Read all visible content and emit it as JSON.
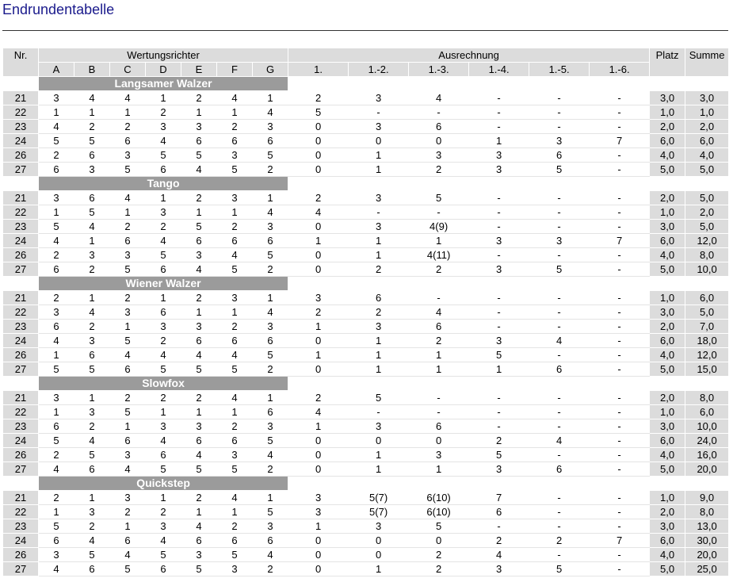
{
  "page_title": "Endrundentabelle",
  "headers": {
    "nr": "Nr.",
    "judges_group": "Wertungsrichter",
    "calc_group": "Ausrechnung",
    "platz": "Platz",
    "summe": "Summe",
    "judges": [
      "A",
      "B",
      "C",
      "D",
      "E",
      "F",
      "G"
    ],
    "calc": [
      "1.",
      "1.-2.",
      "1.-3.",
      "1.-4.",
      "1.-5.",
      "1.-6."
    ]
  },
  "dances": [
    {
      "name": "Langsamer Walzer",
      "rows": [
        {
          "nr": "21",
          "marks": [
            "3",
            "4",
            "4",
            "1",
            "2",
            "4",
            "1"
          ],
          "calc": [
            "2",
            "3",
            "4",
            "-",
            "-",
            "-"
          ],
          "platz": "3,0",
          "summe": "3,0"
        },
        {
          "nr": "22",
          "marks": [
            "1",
            "1",
            "1",
            "2",
            "1",
            "1",
            "4"
          ],
          "calc": [
            "5",
            "-",
            "-",
            "-",
            "-",
            "-"
          ],
          "platz": "1,0",
          "summe": "1,0"
        },
        {
          "nr": "23",
          "marks": [
            "4",
            "2",
            "2",
            "3",
            "3",
            "2",
            "3"
          ],
          "calc": [
            "0",
            "3",
            "6",
            "-",
            "-",
            "-"
          ],
          "platz": "2,0",
          "summe": "2,0"
        },
        {
          "nr": "24",
          "marks": [
            "5",
            "5",
            "6",
            "4",
            "6",
            "6",
            "6"
          ],
          "calc": [
            "0",
            "0",
            "0",
            "1",
            "3",
            "7"
          ],
          "platz": "6,0",
          "summe": "6,0"
        },
        {
          "nr": "26",
          "marks": [
            "2",
            "6",
            "3",
            "5",
            "5",
            "3",
            "5"
          ],
          "calc": [
            "0",
            "1",
            "3",
            "3",
            "6",
            "-"
          ],
          "platz": "4,0",
          "summe": "4,0"
        },
        {
          "nr": "27",
          "marks": [
            "6",
            "3",
            "5",
            "6",
            "4",
            "5",
            "2"
          ],
          "calc": [
            "0",
            "1",
            "2",
            "3",
            "5",
            "-"
          ],
          "platz": "5,0",
          "summe": "5,0"
        }
      ]
    },
    {
      "name": "Tango",
      "rows": [
        {
          "nr": "21",
          "marks": [
            "3",
            "6",
            "4",
            "1",
            "2",
            "3",
            "1"
          ],
          "calc": [
            "2",
            "3",
            "5",
            "-",
            "-",
            "-"
          ],
          "platz": "2,0",
          "summe": "5,0"
        },
        {
          "nr": "22",
          "marks": [
            "1",
            "5",
            "1",
            "3",
            "1",
            "1",
            "4"
          ],
          "calc": [
            "4",
            "-",
            "-",
            "-",
            "-",
            "-"
          ],
          "platz": "1,0",
          "summe": "2,0"
        },
        {
          "nr": "23",
          "marks": [
            "5",
            "4",
            "2",
            "2",
            "5",
            "2",
            "3"
          ],
          "calc": [
            "0",
            "3",
            "4(9)",
            "-",
            "-",
            "-"
          ],
          "platz": "3,0",
          "summe": "5,0"
        },
        {
          "nr": "24",
          "marks": [
            "4",
            "1",
            "6",
            "4",
            "6",
            "6",
            "6"
          ],
          "calc": [
            "1",
            "1",
            "1",
            "3",
            "3",
            "7"
          ],
          "platz": "6,0",
          "summe": "12,0"
        },
        {
          "nr": "26",
          "marks": [
            "2",
            "3",
            "3",
            "5",
            "3",
            "4",
            "5"
          ],
          "calc": [
            "0",
            "1",
            "4(11)",
            "-",
            "-",
            "-"
          ],
          "platz": "4,0",
          "summe": "8,0"
        },
        {
          "nr": "27",
          "marks": [
            "6",
            "2",
            "5",
            "6",
            "4",
            "5",
            "2"
          ],
          "calc": [
            "0",
            "2",
            "2",
            "3",
            "5",
            "-"
          ],
          "platz": "5,0",
          "summe": "10,0"
        }
      ]
    },
    {
      "name": "Wiener Walzer",
      "rows": [
        {
          "nr": "21",
          "marks": [
            "2",
            "1",
            "2",
            "1",
            "2",
            "3",
            "1"
          ],
          "calc": [
            "3",
            "6",
            "-",
            "-",
            "-",
            "-"
          ],
          "platz": "1,0",
          "summe": "6,0"
        },
        {
          "nr": "22",
          "marks": [
            "3",
            "4",
            "3",
            "6",
            "1",
            "1",
            "4"
          ],
          "calc": [
            "2",
            "2",
            "4",
            "-",
            "-",
            "-"
          ],
          "platz": "3,0",
          "summe": "5,0"
        },
        {
          "nr": "23",
          "marks": [
            "6",
            "2",
            "1",
            "3",
            "3",
            "2",
            "3"
          ],
          "calc": [
            "1",
            "3",
            "6",
            "-",
            "-",
            "-"
          ],
          "platz": "2,0",
          "summe": "7,0"
        },
        {
          "nr": "24",
          "marks": [
            "4",
            "3",
            "5",
            "2",
            "6",
            "6",
            "6"
          ],
          "calc": [
            "0",
            "1",
            "2",
            "3",
            "4",
            "-"
          ],
          "platz": "6,0",
          "summe": "18,0"
        },
        {
          "nr": "26",
          "marks": [
            "1",
            "6",
            "4",
            "4",
            "4",
            "4",
            "5"
          ],
          "calc": [
            "1",
            "1",
            "1",
            "5",
            "-",
            "-"
          ],
          "platz": "4,0",
          "summe": "12,0"
        },
        {
          "nr": "27",
          "marks": [
            "5",
            "5",
            "6",
            "5",
            "5",
            "5",
            "2"
          ],
          "calc": [
            "0",
            "1",
            "1",
            "1",
            "6",
            "-"
          ],
          "platz": "5,0",
          "summe": "15,0"
        }
      ]
    },
    {
      "name": "Slowfox",
      "rows": [
        {
          "nr": "21",
          "marks": [
            "3",
            "1",
            "2",
            "2",
            "2",
            "4",
            "1"
          ],
          "calc": [
            "2",
            "5",
            "-",
            "-",
            "-",
            "-"
          ],
          "platz": "2,0",
          "summe": "8,0"
        },
        {
          "nr": "22",
          "marks": [
            "1",
            "3",
            "5",
            "1",
            "1",
            "1",
            "6"
          ],
          "calc": [
            "4",
            "-",
            "-",
            "-",
            "-",
            "-"
          ],
          "platz": "1,0",
          "summe": "6,0"
        },
        {
          "nr": "23",
          "marks": [
            "6",
            "2",
            "1",
            "3",
            "3",
            "2",
            "3"
          ],
          "calc": [
            "1",
            "3",
            "6",
            "-",
            "-",
            "-"
          ],
          "platz": "3,0",
          "summe": "10,0"
        },
        {
          "nr": "24",
          "marks": [
            "5",
            "4",
            "6",
            "4",
            "6",
            "6",
            "5"
          ],
          "calc": [
            "0",
            "0",
            "0",
            "2",
            "4",
            "-"
          ],
          "platz": "6,0",
          "summe": "24,0"
        },
        {
          "nr": "26",
          "marks": [
            "2",
            "5",
            "3",
            "6",
            "4",
            "3",
            "4"
          ],
          "calc": [
            "0",
            "1",
            "3",
            "5",
            "-",
            "-"
          ],
          "platz": "4,0",
          "summe": "16,0"
        },
        {
          "nr": "27",
          "marks": [
            "4",
            "6",
            "4",
            "5",
            "5",
            "5",
            "2"
          ],
          "calc": [
            "0",
            "1",
            "1",
            "3",
            "6",
            "-"
          ],
          "platz": "5,0",
          "summe": "20,0"
        }
      ]
    },
    {
      "name": "Quickstep",
      "rows": [
        {
          "nr": "21",
          "marks": [
            "2",
            "1",
            "3",
            "1",
            "2",
            "4",
            "1"
          ],
          "calc": [
            "3",
            "5(7)",
            "6(10)",
            "7",
            "-",
            "-"
          ],
          "platz": "1,0",
          "summe": "9,0"
        },
        {
          "nr": "22",
          "marks": [
            "1",
            "3",
            "2",
            "2",
            "1",
            "1",
            "5"
          ],
          "calc": [
            "3",
            "5(7)",
            "6(10)",
            "6",
            "-",
            "-"
          ],
          "platz": "2,0",
          "summe": "8,0"
        },
        {
          "nr": "23",
          "marks": [
            "5",
            "2",
            "1",
            "3",
            "4",
            "2",
            "3"
          ],
          "calc": [
            "1",
            "3",
            "5",
            "-",
            "-",
            "-"
          ],
          "platz": "3,0",
          "summe": "13,0"
        },
        {
          "nr": "24",
          "marks": [
            "6",
            "4",
            "6",
            "4",
            "6",
            "6",
            "6"
          ],
          "calc": [
            "0",
            "0",
            "0",
            "2",
            "2",
            "7"
          ],
          "platz": "6,0",
          "summe": "30,0"
        },
        {
          "nr": "26",
          "marks": [
            "3",
            "5",
            "4",
            "5",
            "3",
            "5",
            "4"
          ],
          "calc": [
            "0",
            "0",
            "2",
            "4",
            "-",
            "-"
          ],
          "platz": "4,0",
          "summe": "20,0"
        },
        {
          "nr": "27",
          "marks": [
            "4",
            "6",
            "5",
            "6",
            "5",
            "3",
            "2"
          ],
          "calc": [
            "0",
            "1",
            "2",
            "3",
            "5",
            "-"
          ],
          "platz": "5,0",
          "summe": "25,0"
        }
      ]
    }
  ]
}
